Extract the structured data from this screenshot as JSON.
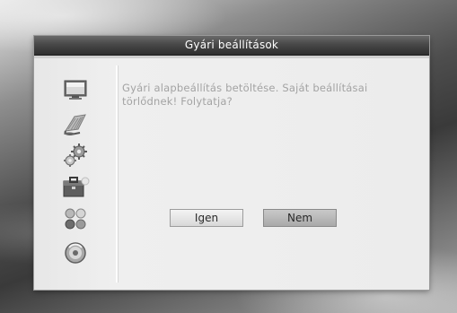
{
  "dialog": {
    "title": "Gyári beállítások",
    "message": "Gyári alapbeállítás betöltése. Saját beállításai törlődnek! Folytatja?",
    "buttons": {
      "yes_label": "Igen",
      "no_label": "Nem"
    },
    "focused_button": "no"
  },
  "sidebar": {
    "icons": [
      {
        "name": "tv-screen-icon"
      },
      {
        "name": "antenna-dish-icon"
      },
      {
        "name": "gears-icon"
      },
      {
        "name": "toolbox-icon"
      },
      {
        "name": "game-circles-icon"
      },
      {
        "name": "info-disc-icon"
      }
    ]
  },
  "colors": {
    "title_bar": "#484848",
    "message_text": "#a3a3a3",
    "button_focused": "#b5b5b5",
    "panel_background": "#ececec"
  }
}
